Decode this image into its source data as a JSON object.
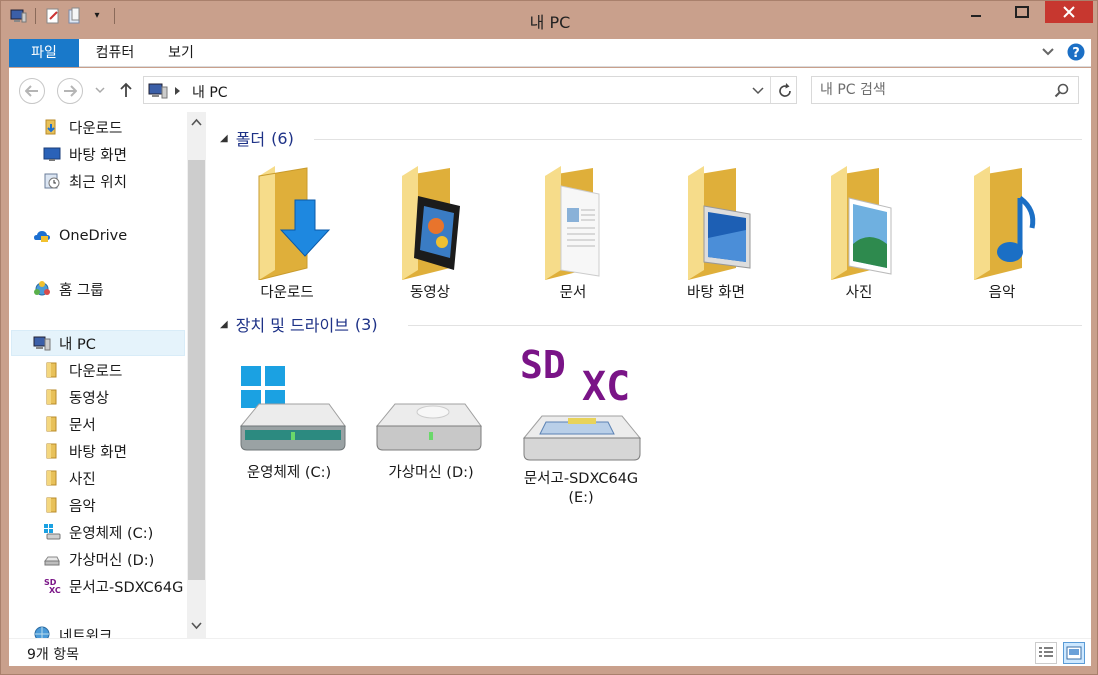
{
  "window": {
    "title": "내 PC",
    "colors": {
      "frame": "#c9a08c",
      "file_tab": "#1979ca",
      "close": "#c7372f",
      "group_header": "#1e3287"
    }
  },
  "ribbon": {
    "tabs": [
      {
        "label": "파일",
        "active": true
      },
      {
        "label": "컴퓨터"
      },
      {
        "label": "보기"
      }
    ]
  },
  "address": {
    "path": "내 PC",
    "search_placeholder": "내 PC 검색"
  },
  "nav": {
    "quick": [
      {
        "label": "다운로드",
        "icon": "download-folder-icon"
      },
      {
        "label": "바탕 화면",
        "icon": "desktop-icon"
      },
      {
        "label": "최근 위치",
        "icon": "recent-places-icon"
      }
    ],
    "onedrive": "OneDrive",
    "homegroup": "홈 그룹",
    "thispc": "내 PC",
    "thispc_children": [
      {
        "label": "다운로드",
        "icon": "folder-icon"
      },
      {
        "label": "동영상",
        "icon": "folder-icon"
      },
      {
        "label": "문서",
        "icon": "folder-icon"
      },
      {
        "label": "바탕 화면",
        "icon": "folder-icon"
      },
      {
        "label": "사진",
        "icon": "folder-icon"
      },
      {
        "label": "음악",
        "icon": "folder-icon"
      },
      {
        "label": "운영체제 (C:)",
        "icon": "windows-drive-icon"
      },
      {
        "label": "가상머신 (D:)",
        "icon": "drive-icon"
      },
      {
        "label": "문서고-SDXC64G",
        "icon": "sdxc-icon"
      }
    ],
    "network": "네트워크"
  },
  "content": {
    "folders_header": "폴더",
    "folders_count": "(6)",
    "folders": [
      {
        "label": "다운로드",
        "overlay": "download-arrow"
      },
      {
        "label": "동영상",
        "overlay": "film"
      },
      {
        "label": "문서",
        "overlay": "document"
      },
      {
        "label": "바탕 화면",
        "overlay": "desktop"
      },
      {
        "label": "사진",
        "overlay": "picture"
      },
      {
        "label": "음악",
        "overlay": "music-note"
      }
    ],
    "drives_header": "장치 및 드라이브",
    "drives_count": "(3)",
    "drives": [
      {
        "label": "운영체제 (C:)",
        "icon": "windows-drive-icon"
      },
      {
        "label": "가상머신 (D:)",
        "icon": "drive-icon"
      },
      {
        "label": "문서고-SDXC64G (E:)",
        "icon": "sdxc-drive-icon"
      }
    ]
  },
  "status": {
    "item_count": "9개 항목"
  }
}
